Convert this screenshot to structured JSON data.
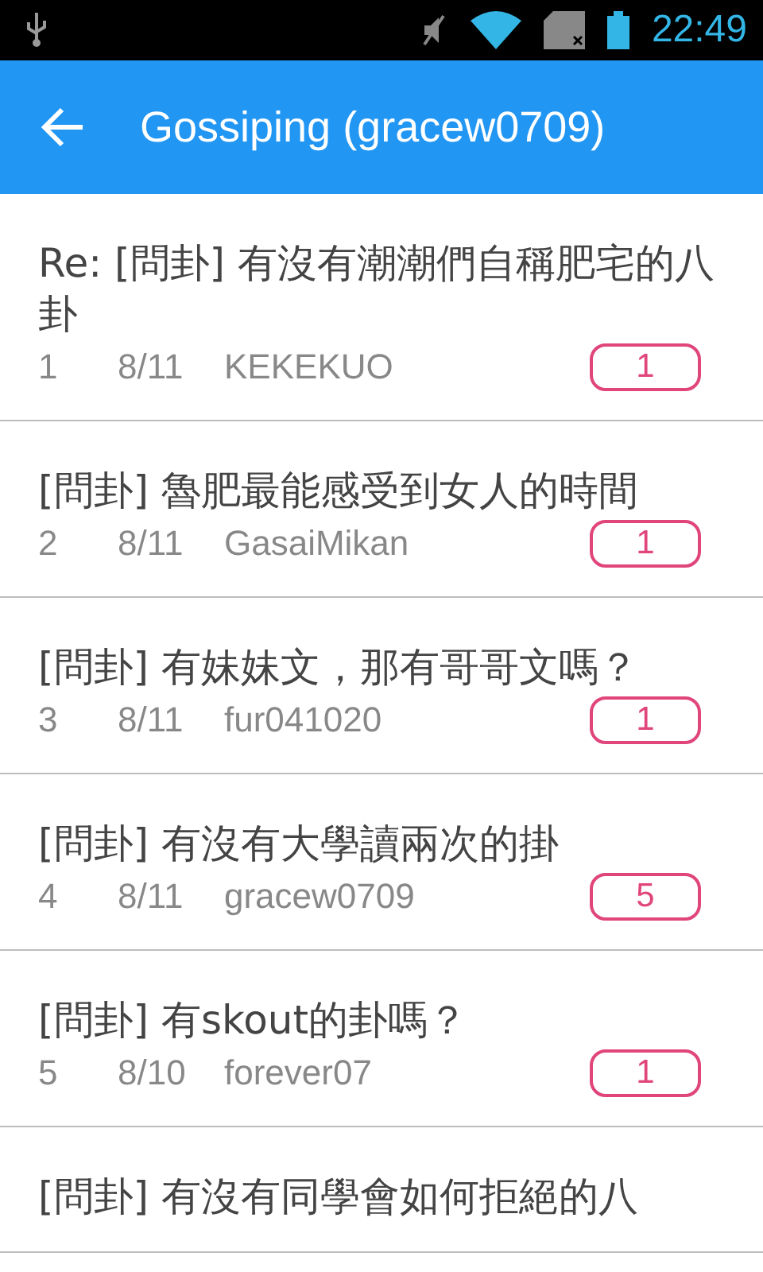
{
  "status_bar": {
    "time": "22:49"
  },
  "app_bar": {
    "title": "Gossiping (gracew0709)"
  },
  "posts": [
    {
      "title": "Re: [問卦] 有沒有潮潮們自稱肥宅的八卦",
      "number": "1",
      "date": "8/11",
      "author": "KEKEKUO",
      "count": "1"
    },
    {
      "title": "[問卦] 魯肥最能感受到女人的時間",
      "number": "2",
      "date": "8/11",
      "author": "GasaiMikan",
      "count": "1"
    },
    {
      "title": "[問卦] 有妹妹文，那有哥哥文嗎？",
      "number": "3",
      "date": "8/11",
      "author": "fur041020",
      "count": "1"
    },
    {
      "title": "[問卦] 有沒有大學讀兩次的掛",
      "number": "4",
      "date": "8/11",
      "author": "gracew0709",
      "count": "5"
    },
    {
      "title": "[問卦] 有skout的卦嗎？",
      "number": "5",
      "date": "8/10",
      "author": "forever07",
      "count": "1"
    },
    {
      "title": "[問卦] 有沒有同學會如何拒絕的八"
    }
  ]
}
